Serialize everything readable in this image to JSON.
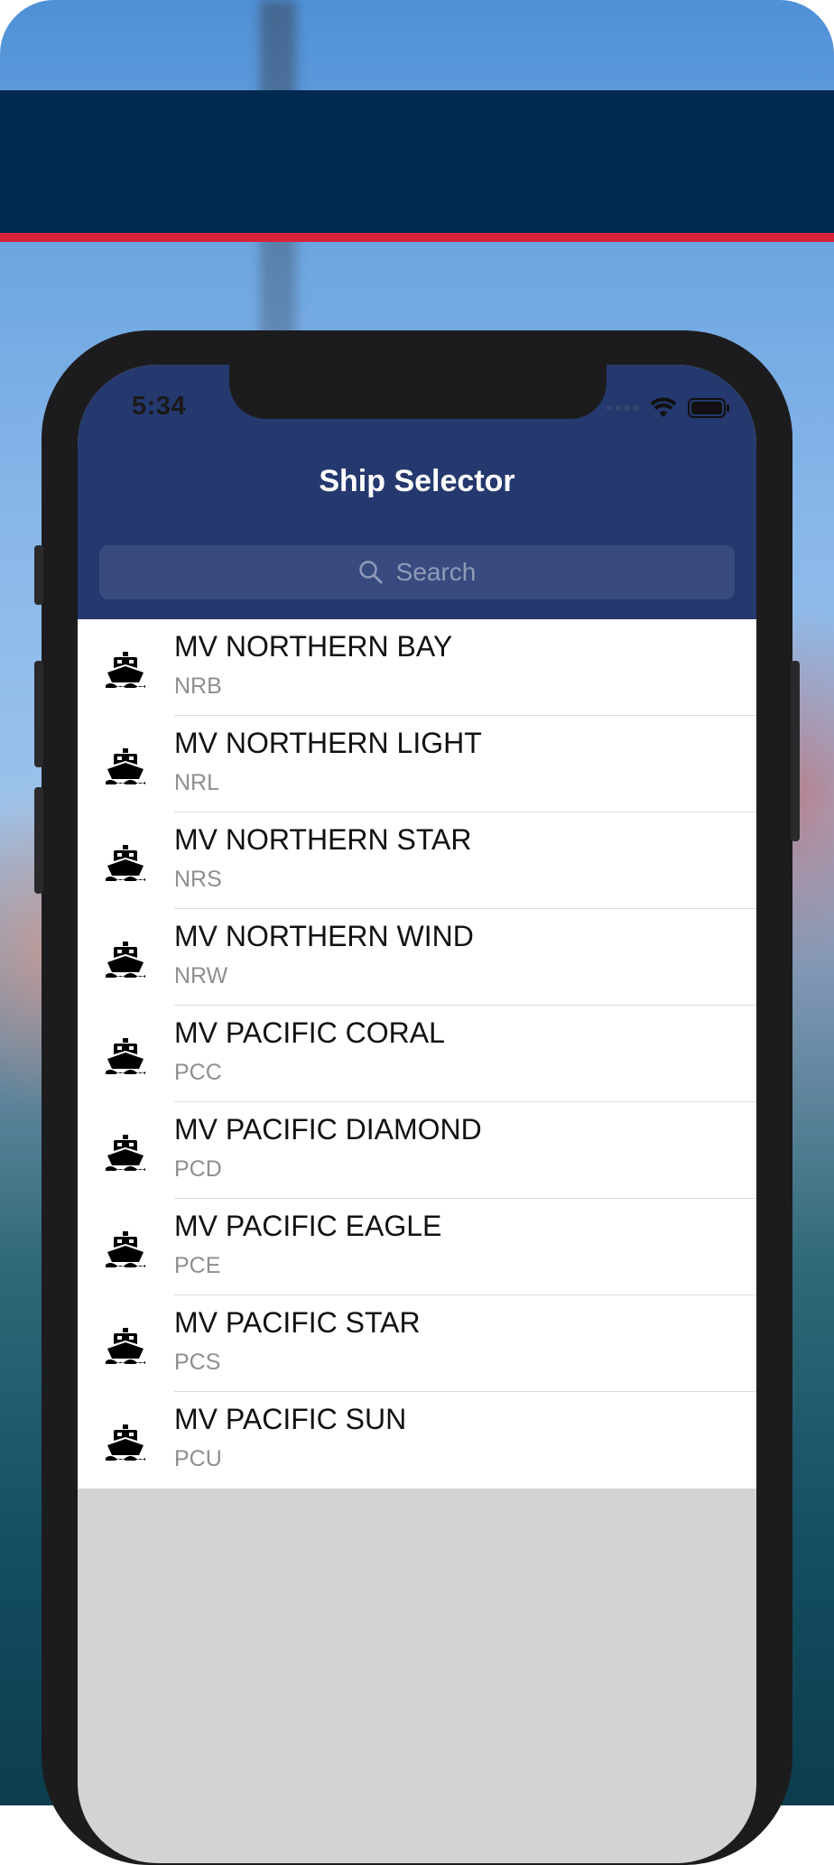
{
  "status_bar": {
    "time": "5:34"
  },
  "nav": {
    "title": "Ship Selector"
  },
  "search": {
    "placeholder": "Search"
  },
  "ships": [
    {
      "name": "MV NORTHERN BAY",
      "code": "NRB"
    },
    {
      "name": "MV NORTHERN LIGHT",
      "code": "NRL"
    },
    {
      "name": "MV NORTHERN STAR",
      "code": "NRS"
    },
    {
      "name": "MV NORTHERN WIND",
      "code": "NRW"
    },
    {
      "name": "MV PACIFIC CORAL",
      "code": "PCC"
    },
    {
      "name": "MV PACIFIC DIAMOND",
      "code": "PCD"
    },
    {
      "name": "MV PACIFIC EAGLE",
      "code": "PCE"
    },
    {
      "name": "MV PACIFIC STAR",
      "code": "PCS"
    },
    {
      "name": "MV PACIFIC SUN",
      "code": "PCU"
    }
  ],
  "icons": {
    "row_icon": "ship-icon",
    "search_icon": "magnifier-icon"
  },
  "colors": {
    "nav_background": "#25396e",
    "top_band": "#002a4f",
    "accent_stripe": "#d8223a"
  }
}
